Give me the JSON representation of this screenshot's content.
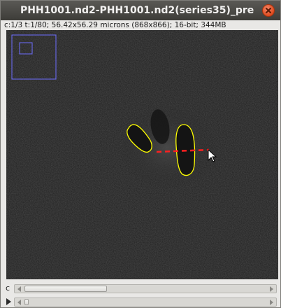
{
  "window": {
    "title": "PHH1001.nd2-PHH1001.nd2(series35)_pre",
    "info": "c:1/3 t:1/80; 56.42x56.29 microns (868x866); 16-bit; 344MB"
  },
  "colors": {
    "titlebar": "#3d3c38",
    "close": "#df4b1f",
    "roi_outline": "#ffff00",
    "line_roi": "#ff0000",
    "navigator": "#6d6dff",
    "image_background": "#262626"
  },
  "scrollbars": {
    "channel": {
      "label": "c",
      "position": 0.333
    },
    "time": {
      "position": 0.0125
    }
  },
  "icons": {
    "close": "close-x-icon",
    "scroll_left": "left-arrow-icon",
    "scroll_right": "right-arrow-icon",
    "play": "play-triangle-icon",
    "cursor": "mouse-pointer-icon"
  }
}
